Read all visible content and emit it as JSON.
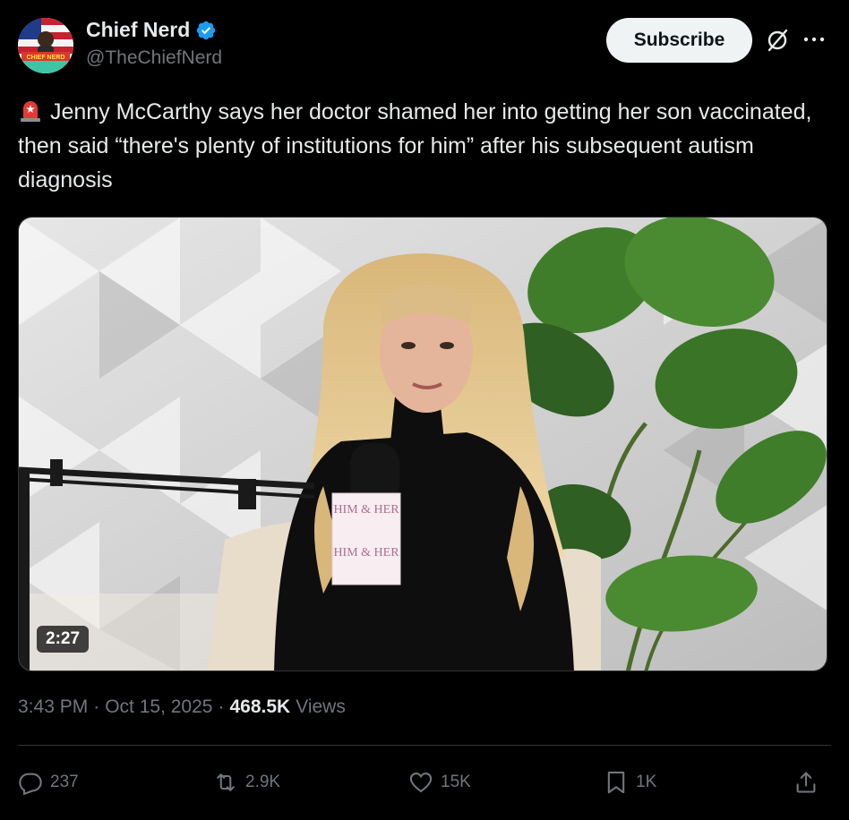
{
  "author": {
    "name": "Chief Nerd",
    "handle": "@TheChiefNerd",
    "avatar_badge_text": "CHIEF NERD",
    "verified_color": "#1d9bf0"
  },
  "header": {
    "subscribe_label": "Subscribe",
    "grok_icon": "grok-icon",
    "more_icon": "more-icon"
  },
  "tweet": {
    "emoji": "siren-emoji",
    "text": "Jenny McCarthy says her doctor shamed her into getting her son vaccinated, then said “there's plenty of institutions for him” after his subsequent autism diagnosis"
  },
  "media": {
    "duration": "2:27",
    "mic_cube_top": "HIM & HER",
    "mic_cube_bottom": "HIM & HER"
  },
  "meta": {
    "time": "3:43 PM",
    "sep1": "·",
    "date": "Oct 15, 2025",
    "sep2": "·",
    "views_count": "468.5K",
    "views_label": "Views"
  },
  "actions": {
    "replies": "237",
    "reposts": "2.9K",
    "likes": "15K",
    "bookmarks": "1K"
  },
  "colors": {
    "background": "#000000",
    "text": "#e7e9ea",
    "muted": "#71767b",
    "subscribe_bg": "#eff3f4",
    "divider": "#2f3336"
  }
}
